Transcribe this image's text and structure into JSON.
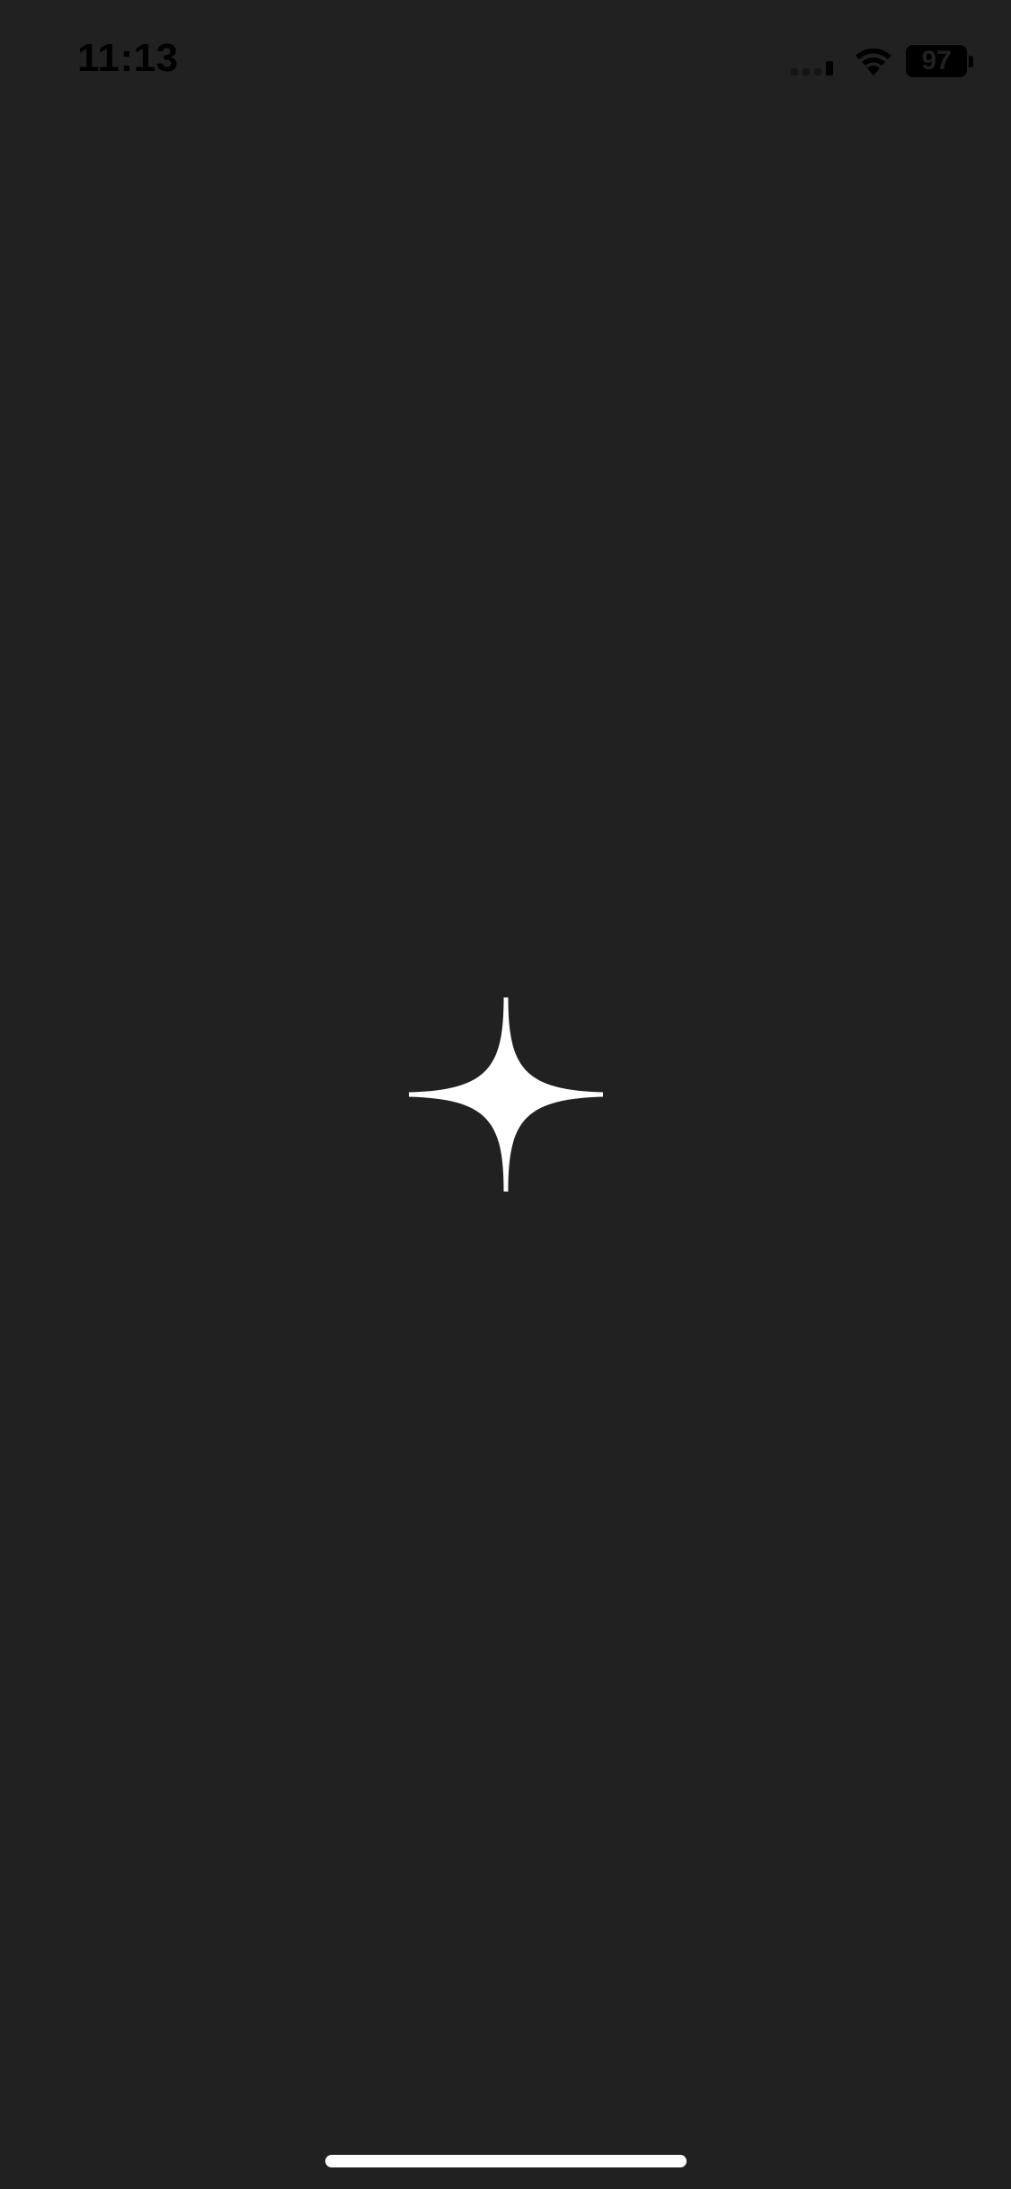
{
  "status_bar": {
    "time": "11:13",
    "battery_level": "97",
    "icons": [
      "signal-icon",
      "wifi-icon",
      "battery-icon"
    ]
  },
  "main": {
    "icon": "sparkle-icon"
  },
  "colors": {
    "background": "#212121",
    "status_text": "#000000",
    "sparkle": "#ffffff",
    "home_indicator": "#ffffff"
  }
}
